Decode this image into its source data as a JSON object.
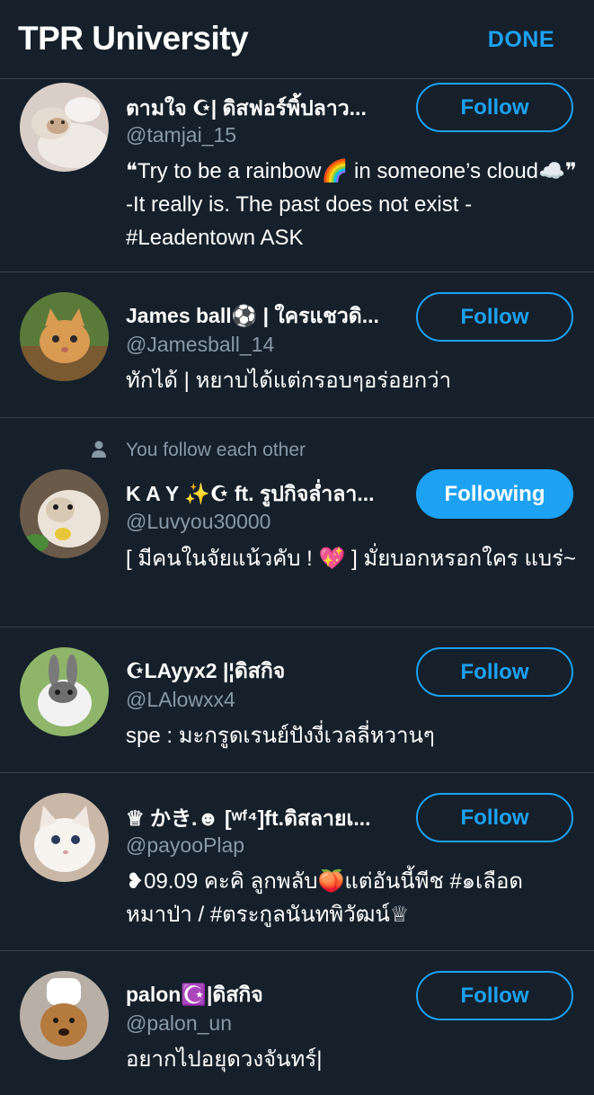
{
  "header": {
    "title": "TPR University",
    "done_label": "DONE"
  },
  "colors": {
    "background": "#15202b",
    "accent": "#1da1f2",
    "secondary_text": "#8899a6",
    "divider": "#38444d"
  },
  "users": [
    {
      "name": "ตามใจ ☪| ดิสฟอร์พิ้ปลาว...",
      "handle": "@tamjai_15",
      "bio": "❝Try to be a rainbow🌈 in someone’s cloud☁️❞ -It really is. The past does not exist - #Leadentown ASK",
      "button": "Follow",
      "following": false
    },
    {
      "name": "James ball⚽ | ใครแชวดิ...",
      "handle": "@Jamesball_14",
      "bio": "ทักได้ | หยาบได้แต่กรอบๆอร่อยกว่า",
      "button": "Follow",
      "following": false
    },
    {
      "context": "You follow each other",
      "context_icon": "person-icon",
      "name": "K A Y ✨☪ ft. รูปกิจล่ำลา...",
      "handle": "@Luvyou30000",
      "bio": "[ มีคนในจัยแน้วคับ ! 💖 ] มั่ยบอกหรอกใคร แบร่~",
      "button": "Following",
      "following": true
    },
    {
      "name": "☪LAyyx2 |¦ดิสกิจ",
      "handle": "@LAlowxx4",
      "bio": "spe : มะกรูดเรนย์ปังงี่เวลลี่หวานๆ",
      "button": "Follow",
      "following": false
    },
    {
      "name": "♕ かき.☻ [ʷᶠ⁴]ft.ดิสลายเ...",
      "handle": "@payooPlap",
      "bio": "❥09.09 คะคิ ลูกพลับ🍑แต่อันนี้พีช #๑เลือดหมาป่า / #ตระกูลนันทพิวัฒน์♕",
      "button": "Follow",
      "following": false
    },
    {
      "name": "palon☪️|ดิสกิจ",
      "handle": "@palon_un",
      "bio": "อยากไปอยุดวงจันทร์|",
      "button": "Follow",
      "following": false
    }
  ]
}
